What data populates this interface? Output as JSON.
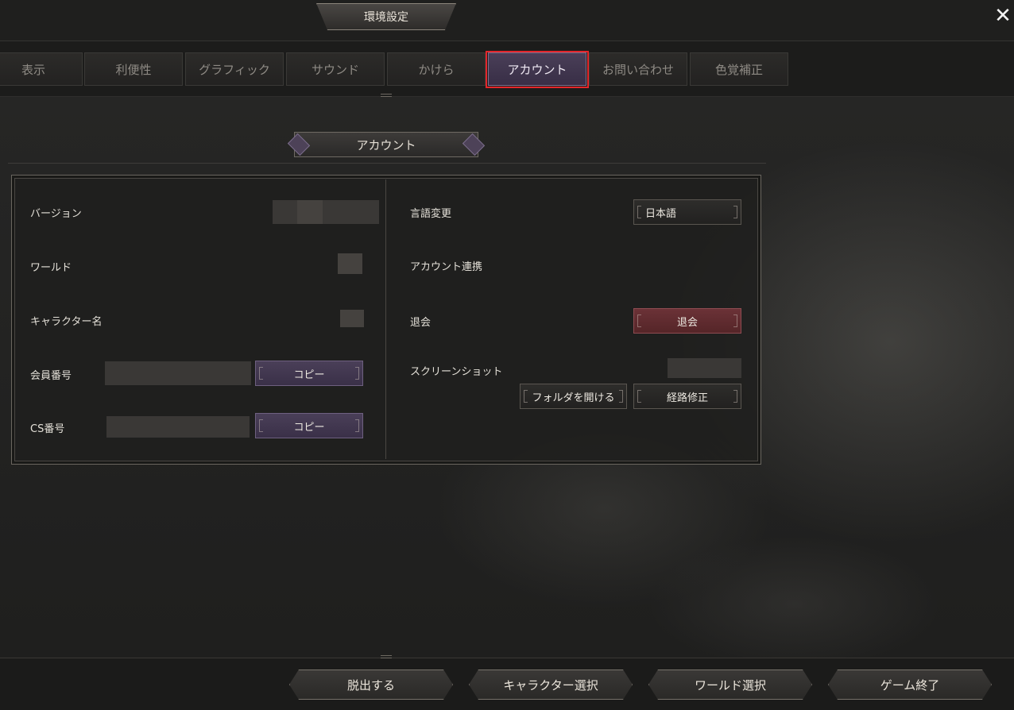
{
  "header": {
    "title": "環境設定",
    "close_icon": "close-icon"
  },
  "tabs": [
    {
      "label": "表示",
      "active": false
    },
    {
      "label": "利便性",
      "active": false
    },
    {
      "label": "グラフィック",
      "active": false
    },
    {
      "label": "サウンド",
      "active": false
    },
    {
      "label": "かけら",
      "active": false
    },
    {
      "label": "アカウント",
      "active": true
    },
    {
      "label": "お問い合わせ",
      "active": false
    },
    {
      "label": "色覚補正",
      "active": false
    }
  ],
  "section": {
    "title": "アカウント"
  },
  "left": {
    "version_label": "バージョン",
    "world_label": "ワールド",
    "character_label": "キャラクター名",
    "member_label": "会員番号",
    "member_copy": "コピー",
    "cs_label": "CS番号",
    "cs_copy": "コピー"
  },
  "right": {
    "language_label": "言語変更",
    "language_value": "日本語",
    "link_label": "アカウント連携",
    "withdraw_label": "退会",
    "withdraw_button": "退会",
    "screenshot_label": "スクリーンショット",
    "open_folder_button": "フォルダを開ける",
    "change_path_button": "経路修正"
  },
  "footer": {
    "exit": "脱出する",
    "char_select": "キャラクター選択",
    "world_select": "ワールド選択",
    "quit": "ゲーム終了"
  },
  "colors": {
    "active_tab": "#4a3f58",
    "highlight": "#e3262b",
    "withdraw": "#6b3237"
  }
}
